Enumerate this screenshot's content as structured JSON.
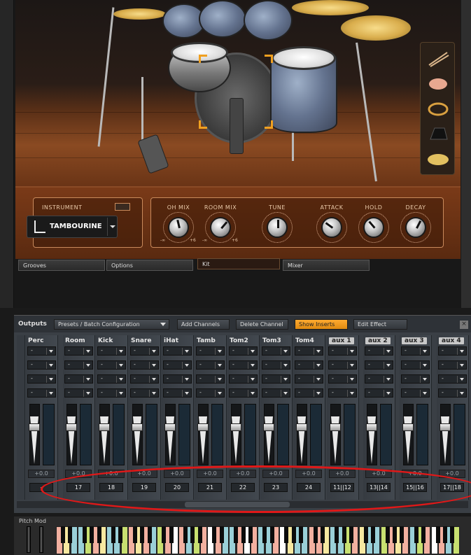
{
  "instrument": {
    "section_label": "INSTRUMENT",
    "selected": "TAMBOURINE"
  },
  "controls": [
    {
      "id": "oh-mix",
      "label": "OH MIX",
      "min": "-∞",
      "max": "+6",
      "value": 0.45
    },
    {
      "id": "room-mix",
      "label": "ROOM MIX",
      "min": "-∞",
      "max": "+6",
      "value": 0.65
    },
    {
      "id": "tune",
      "label": "TUNE",
      "value": 0.5
    },
    {
      "id": "attack",
      "label": "ATTACK",
      "value": 0.3
    },
    {
      "id": "hold",
      "label": "HOLD",
      "value": 0.35
    },
    {
      "id": "decay",
      "label": "DECAY",
      "value": 0.6
    }
  ],
  "tabs": [
    {
      "label": "Grooves",
      "active": false
    },
    {
      "label": "Options",
      "active": false
    },
    {
      "label": "Kit",
      "active": true
    },
    {
      "label": "Mixer",
      "active": false
    }
  ],
  "mixer": {
    "outputs_label": "Outputs",
    "toolbar": {
      "presets": "Presets / Batch Configuration",
      "add_channels": "Add Channels",
      "delete_channel": "Delete Channel",
      "show_inserts": "Show Inserts",
      "edit_effect": "Edit Effect",
      "close": "×"
    },
    "insert_placeholder": "-",
    "gain_text": "+0.0",
    "channels": [
      {
        "name": "Perc",
        "out": "-",
        "aux": false
      },
      {
        "name": "Room",
        "out": "17",
        "aux": false
      },
      {
        "name": "Kick",
        "out": "18",
        "aux": false
      },
      {
        "name": "Snare",
        "out": "19",
        "aux": false
      },
      {
        "name": "iHat",
        "out": "20",
        "aux": false
      },
      {
        "name": "Tamb",
        "out": "21",
        "aux": false
      },
      {
        "name": "Tom2",
        "out": "22",
        "aux": false
      },
      {
        "name": "Tom3",
        "out": "23",
        "aux": false
      },
      {
        "name": "Tom4",
        "out": "24",
        "aux": false
      },
      {
        "name": "aux 1",
        "out": "11||12",
        "aux": true
      },
      {
        "name": "aux 2",
        "out": "13||14",
        "aux": true
      },
      {
        "name": "aux 3",
        "out": "15||16",
        "aux": true
      },
      {
        "name": "aux 4",
        "out": "17||18",
        "aux": true
      }
    ]
  },
  "keyboard": {
    "pitch_label": "Pitch Mod"
  },
  "colors": {
    "highlight": "#e01818",
    "show_inserts_bg": "#f0a020"
  }
}
